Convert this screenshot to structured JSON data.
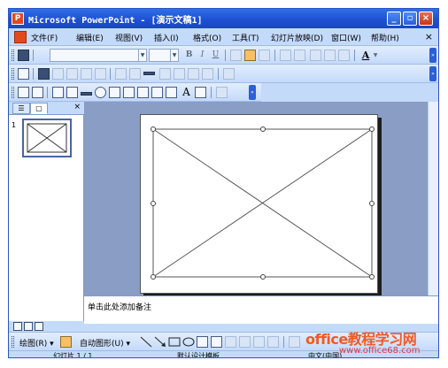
{
  "window": {
    "title": "Microsoft PowerPoint - [演示文稿1]",
    "app_icon": "P"
  },
  "menubar": {
    "items": [
      "文件(F)",
      "编辑(E)",
      "视图(V)",
      "插入(I)",
      "格式(O)",
      "工具(T)",
      "幻灯片放映(D)",
      "窗口(W)",
      "帮助(H)"
    ],
    "close": "×"
  },
  "format_toolbar": {
    "bold": "B",
    "italic": "I",
    "underline": "U",
    "font_color": "A"
  },
  "drawing_toolbar": {
    "font_size_a": "A"
  },
  "left_pane": {
    "tab_outline": "☰",
    "tab_slides": "▢",
    "close": "×",
    "slide_number": "1"
  },
  "notes": {
    "placeholder": "单击此处添加备注"
  },
  "draw_bar": {
    "draw_label": "绘图(R) ▾",
    "autoshapes_label": "自动图形(U) ▾"
  },
  "status": {
    "slide": "幻灯片 1 / 1",
    "design": "默认设计模板",
    "language": "中文(中国)"
  },
  "watermark": {
    "site_cn": "office教程学习网",
    "site_url": "www.office68.com"
  }
}
